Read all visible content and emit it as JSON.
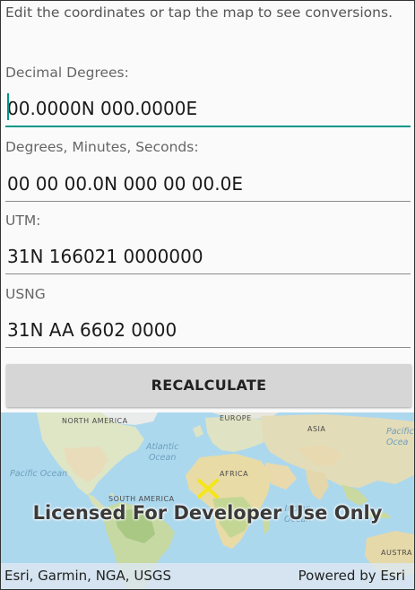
{
  "instructions": "Edit the coordinates or tap the map to see conversions.",
  "fields": [
    {
      "label": "Decimal Degrees:",
      "value": "00.0000N 000.0000E"
    },
    {
      "label": "Degrees, Minutes, Seconds:",
      "value": "00 00 00.0N 000 00 00.0E"
    },
    {
      "label": "UTM:",
      "value": "31N 166021 0000000"
    },
    {
      "label": "USNG",
      "value": "31N AA 6602 0000"
    }
  ],
  "recalculate_label": "RECALCULATE",
  "map": {
    "labels": {
      "north_america": "NORTH AMERICA",
      "europe": "EUROPE",
      "asia": "ASIA",
      "atlantic_ocean": "Atlantic\nOcean",
      "pacific_ocean": "Pacific Ocean",
      "pacific_ocean_right": "Pacific\nOcea",
      "indian_ocean": "Indian\nOcean",
      "africa": "AFRICA",
      "south_america": "SOUTH AMERICA",
      "australia": "AUSTRA"
    },
    "watermark": "Licensed For Developer Use Only",
    "attribution": "Esri, Garmin, NGA, USGS",
    "powered_by": "Powered by Esri",
    "marker_icon": "x-marker-icon",
    "marker_color": "#f5e61a"
  }
}
